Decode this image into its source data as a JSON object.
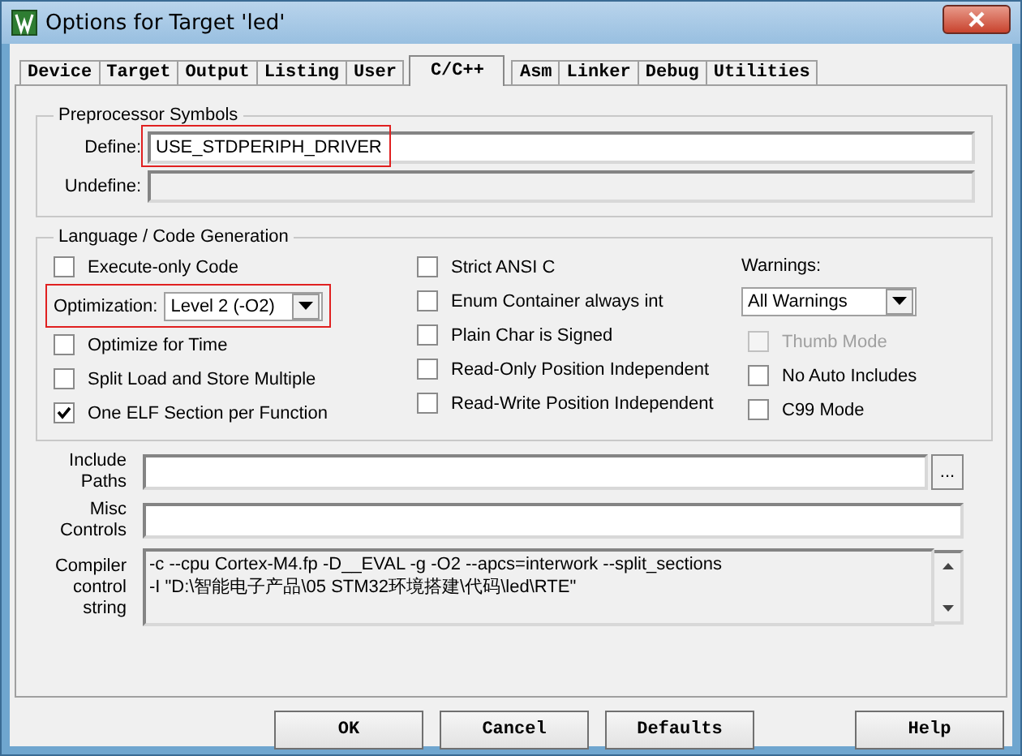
{
  "window": {
    "title": "Options for Target 'led'"
  },
  "tabs": [
    {
      "label": "Device",
      "selected": false
    },
    {
      "label": "Target",
      "selected": false
    },
    {
      "label": "Output",
      "selected": false
    },
    {
      "label": "Listing",
      "selected": false
    },
    {
      "label": "User",
      "selected": false
    },
    {
      "label": "C/C++",
      "selected": true
    },
    {
      "label": "Asm",
      "selected": false
    },
    {
      "label": "Linker",
      "selected": false
    },
    {
      "label": "Debug",
      "selected": false
    },
    {
      "label": "Utilities",
      "selected": false
    }
  ],
  "preprocessor": {
    "title": "Preprocessor Symbols",
    "fields": [
      {
        "label": "Define:",
        "value": "USE_STDPERIPH_DRIVER",
        "disabled": false,
        "highlighted": true
      },
      {
        "label": "Undefine:",
        "disabled": true,
        "highlighted": false
      }
    ]
  },
  "language": {
    "title": "Language / Code Generation",
    "left": [
      {
        "kind": "checkbox",
        "label": "Execute-only Code",
        "checked": false
      },
      {
        "kind": "dropdown",
        "label": "Optimization:",
        "value": "Level 2 (-O2)",
        "highlighted": true
      },
      {
        "kind": "checkbox",
        "label": "Optimize for Time",
        "checked": false
      },
      {
        "kind": "checkbox",
        "label": "Split Load and Store Multiple",
        "checked": false
      },
      {
        "kind": "checkbox",
        "label": "One ELF Section per Function",
        "checked": true
      }
    ],
    "middle": [
      {
        "kind": "checkbox",
        "label": "Strict ANSI C",
        "checked": false
      },
      {
        "kind": "checkbox",
        "label": "Enum Container always int",
        "checked": false
      },
      {
        "kind": "checkbox",
        "label": "Plain Char is Signed",
        "checked": false
      },
      {
        "kind": "checkbox",
        "label": "Read-Only Position Independent",
        "checked": false
      },
      {
        "kind": "checkbox",
        "label": "Read-Write Position Independent",
        "checked": false
      }
    ],
    "right": [
      {
        "kind": "label",
        "label": "Warnings:"
      },
      {
        "kind": "dropdown",
        "value": "All Warnings",
        "highlighted": false
      },
      {
        "kind": "checkbox",
        "label": "Thumb Mode",
        "checked": false,
        "disabled": true
      },
      {
        "kind": "checkbox",
        "label": "No Auto Includes",
        "checked": false,
        "disabled": false
      },
      {
        "kind": "checkbox",
        "label": "C99 Mode",
        "checked": false,
        "disabled": false
      }
    ]
  },
  "fields": [
    {
      "kind": "browse",
      "label": "Include Paths",
      "browse": "..."
    },
    {
      "kind": "plain",
      "label": "Misc Controls"
    }
  ],
  "compiler": {
    "label": "Compiler control string",
    "lines": [
      "-c --cpu Cortex-M4.fp -D__EVAL -g -O2 --apcs=interwork --split_sections",
      "-I \"D:\\智能电子产品\\05 STM32环境搭建\\代码\\led\\RTE\""
    ]
  },
  "buttons": [
    {
      "label": "OK"
    },
    {
      "label": "Cancel"
    },
    {
      "label": "Defaults"
    },
    {
      "label": "Help",
      "kind": "help"
    }
  ]
}
